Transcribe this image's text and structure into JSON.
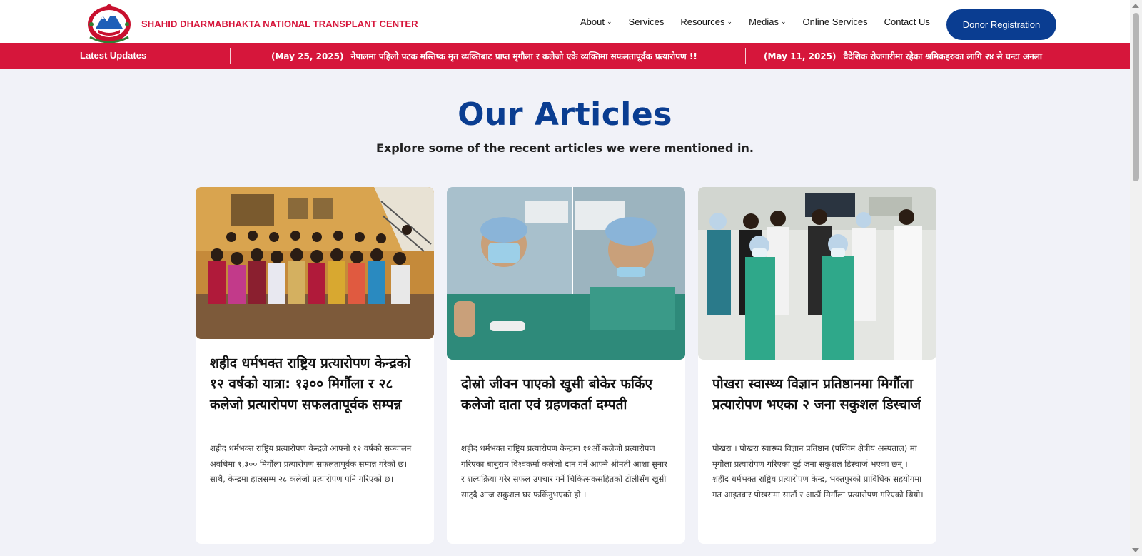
{
  "header": {
    "brand": "SHAHID DHARMABHAKTA NATIONAL TRANSPLANT CENTER",
    "nav": [
      {
        "label": "About",
        "dropdown": true
      },
      {
        "label": "Services",
        "dropdown": false
      },
      {
        "label": "Resources",
        "dropdown": true
      },
      {
        "label": "Medias",
        "dropdown": true
      },
      {
        "label": "Online Services",
        "dropdown": false
      },
      {
        "label": "Contact Us",
        "dropdown": false
      }
    ],
    "cta": "Donor Registration"
  },
  "ticker": {
    "label": "Latest Updates",
    "items": [
      {
        "date": "(May 25, 2025)",
        "text": "नेपालमा पहिलो पटक मस्तिष्क मृत व्यक्तिबाट प्राप्त मृगौला र कलेजो एके व्यक्तिमा सफलतापूर्वक प्रत्यारोपण !!"
      },
      {
        "date": "(May 11, 2025)",
        "text": "वैदेशिक रोजगारीमा रहेका श्रमिकहरुका लागि २४ से घन्टा अनला"
      }
    ]
  },
  "section": {
    "title": "Our Articles",
    "subtitle": "Explore some of the recent articles we were mentioned in."
  },
  "articles": [
    {
      "title": "शहीद धर्मभक्त राष्ट्रिय प्रत्यारोपण केन्द्रको १२ वर्षको यात्रा: १३०० मिर्गौला र २८ कलेजो प्रत्यारोपण सफलतापूर्वक सम्पन्न",
      "description": "शहीद धर्मभक्त राष्ट्रिय प्रत्यारोपण केन्द्रले आफ्नो १२ वर्षको सञ्चालन अवधिमा १,३०० मिर्गौला प्रत्यारोपण सफलतापूर्वक सम्पन्न गरेको छ। साथै, केन्द्रमा हालसम्म २८ कलेजो प्रत्यारोपण पनि गरिएको छ।"
    },
    {
      "title": "दोस्रो जीवन पाएको खुसी बोकेर फर्किए कलेजो दाता एवं ग्रहणकर्ता दम्पती",
      "description": "शहीद धर्मभक्त राष्ट्रिय प्रत्यारोपण केन्द्रमा ११औँ कलेजो प्रत्यारोपण गरिएका बाबुराम विश्वकर्मा कलेजो दान गर्ने आफ्नै श्रीमती आशा सुनार र शल्यक्रिया गरेर सफल उपचार गर्ने चिकित्सकसहितको टोलीसँग खुसी साट्दै आज सकुशल घर फर्किनुभएको हो ।"
    },
    {
      "title": "पोखरा स्वास्थ्य विज्ञान प्रतिष्ठानमा मिर्गौला प्रत्यारोपण भएका २ जना सकुशल डिस्चार्ज",
      "description": "पोखरा । पोखरा स्वास्थ्य विज्ञान प्रतिष्ठान (पश्चिम क्षेत्रीय अस्पताल) मा मृगौला प्रत्यारोपण गरिएका दुई जना सकुशल डिस्चार्ज भएका छन् । शहीद धर्मभक्त राष्ट्रिय प्रत्यारोपण केन्द्र, भक्तपुरको प्राविधिक सहयोगमा गत आइतवार पोखरामा सातौं र आठौं मिर्गौला प्रत्यारोपण गरिएको थियो।"
    }
  ],
  "colors": {
    "brand_red": "#d6163b",
    "brand_blue": "#0a3d91",
    "page_bg": "#f1f2f8"
  }
}
